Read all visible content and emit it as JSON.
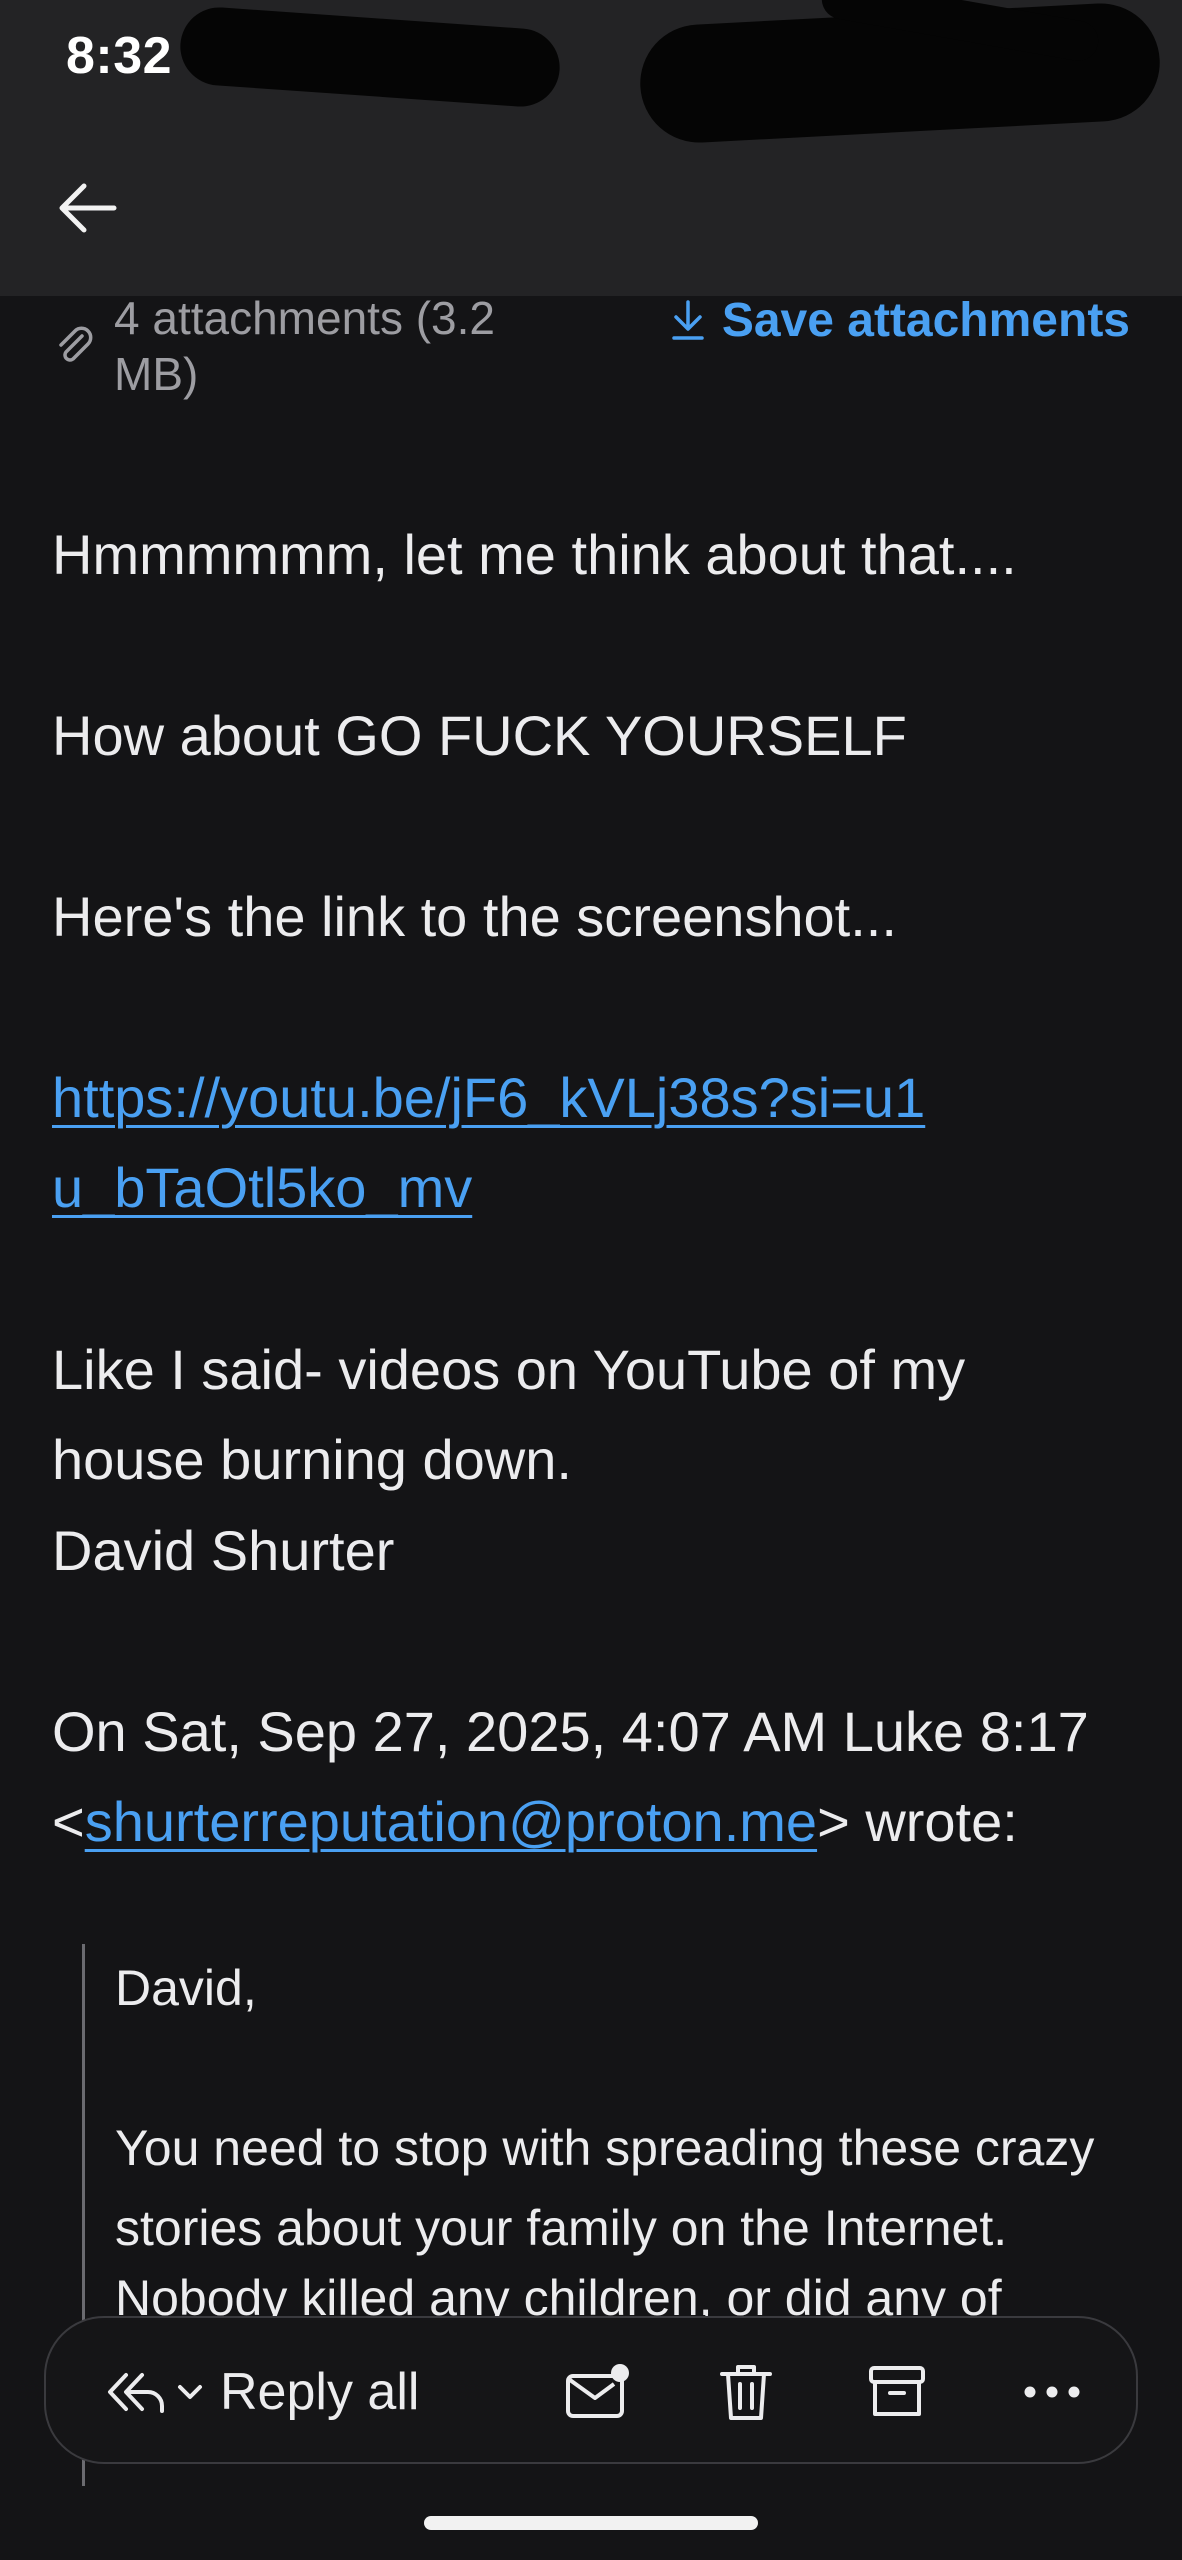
{
  "status_bar": {
    "time": "8:32"
  },
  "header": {
    "back_icon": "arrow-left-icon"
  },
  "attachments": {
    "info": "4 attachments (3.2 MB)",
    "save_label": "Save attachments",
    "icons": [
      "paperclip-icon",
      "download-icon"
    ]
  },
  "message": {
    "line1": "Hmmmmmm, let me think about that....",
    "line2": "How about GO FUCK YOURSELF",
    "line3": "Here's the link to the screenshot...",
    "link": "https://youtu.be/jF6_kVLj38s?si=u1u_bTaOtl5ko_mv",
    "line4": "Like I said- videos on YouTube of my house burning down.",
    "signature": "David Shurter",
    "quote_header_prefix": "On Sat, Sep 27, 2025, 4:07 AM Luke 8:17 <",
    "quote_email": "shurterreputation@proton.me",
    "quote_header_suffix": "> wrote:"
  },
  "quoted": {
    "greeting": "David,",
    "para1": "You need to stop with spreading these crazy stories about your family on the Internet.",
    "para2": "Nobody killed any children, or did any of"
  },
  "action_bar": {
    "reply_all_label": "Reply all",
    "icons": [
      "reply-all-icon",
      "chevron-down-icon",
      "mark-unread-icon",
      "trash-icon",
      "archive-icon",
      "more-icon"
    ]
  },
  "colors": {
    "accent": "#4aa0f2",
    "background": "#141416",
    "header": "#232325"
  }
}
